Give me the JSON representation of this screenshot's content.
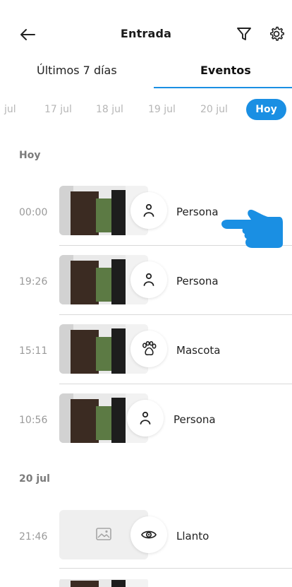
{
  "header": {
    "title": "Entrada",
    "back_icon": "arrow-left-icon",
    "filter_icon": "filter-icon",
    "settings_icon": "gear-icon"
  },
  "tabs": [
    {
      "label": "Últimos 7 días",
      "active": false
    },
    {
      "label": "Eventos",
      "active": true
    }
  ],
  "dates": [
    "jul",
    "17 jul",
    "18 jul",
    "19 jul",
    "20 jul",
    "Hoy"
  ],
  "sections": [
    {
      "label": "Hoy",
      "events": [
        {
          "time": "00:00",
          "type": "Persona",
          "icon": "person-icon",
          "thumb": "photo"
        },
        {
          "time": "19:26",
          "type": "Persona",
          "icon": "person-icon",
          "thumb": "photo"
        },
        {
          "time": "15:11",
          "type": "Mascota",
          "icon": "paw-icon",
          "thumb": "photo"
        },
        {
          "time": "10:56",
          "type": "Persona",
          "icon": "person-icon",
          "thumb": "photo"
        }
      ]
    },
    {
      "label": "20 jul",
      "events": [
        {
          "time": "21:46",
          "type": "Llanto",
          "icon": "eye-icon",
          "thumb": "placeholder"
        }
      ]
    }
  ],
  "colors": {
    "accent": "#1a8fe3"
  }
}
